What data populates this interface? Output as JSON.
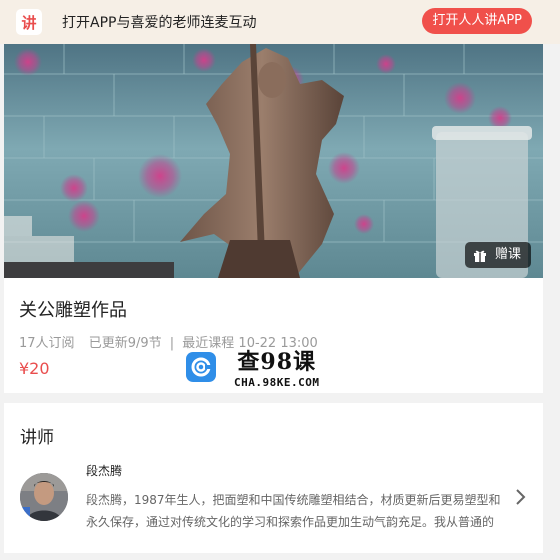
{
  "banner": {
    "logo_char": "讲",
    "text": "打开APP与喜爱的老师连麦互动",
    "open_button": "打开人人讲APP"
  },
  "cover": {
    "gift_label": "赠课"
  },
  "course": {
    "title": "关公雕塑作品",
    "subscribers": "17人订阅",
    "updated": "已更新9/9节",
    "separator": "|",
    "latest": "最近课程 10-22 13:00",
    "price": "¥20"
  },
  "watermark": {
    "title": "查98课",
    "subtitle": "CHA.98KE.COM"
  },
  "teacher": {
    "section_title": "讲师",
    "name": "段杰腾",
    "bio": "段杰腾，1987年生人，把面塑和中国传统雕塑相结合，材质更新后更易塑型和永久保存，通过对传统文化的学习和探索作品更加生动气韵充足。我从普通的"
  },
  "colors": {
    "accent": "#f0504b",
    "price": "#e94d4d",
    "banner_bg": "#f6efe6"
  }
}
